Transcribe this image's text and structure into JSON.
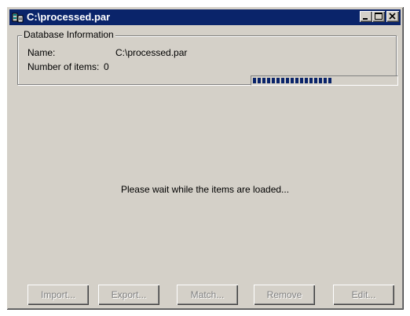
{
  "window": {
    "title": "C:\\processed.par",
    "icon": "database-app-icon",
    "controls": [
      "minimize",
      "maximize",
      "close"
    ]
  },
  "database_info": {
    "group_title": "Database Information",
    "name_label": "Name:",
    "name_value": "C:\\processed.par",
    "items_label": "Number of items:",
    "items_value": "0",
    "load_progress": 0.53
  },
  "message": "Please wait while the items are loaded...",
  "buttons": {
    "import": "Import...",
    "export": "Export...",
    "match": "Match...",
    "remove": "Remove",
    "edit": "Edit..."
  },
  "colors": {
    "title_bar": "#0a246a",
    "face": "#d4d0c8",
    "progress": "#0a246a",
    "disabled_text": "#808080"
  }
}
